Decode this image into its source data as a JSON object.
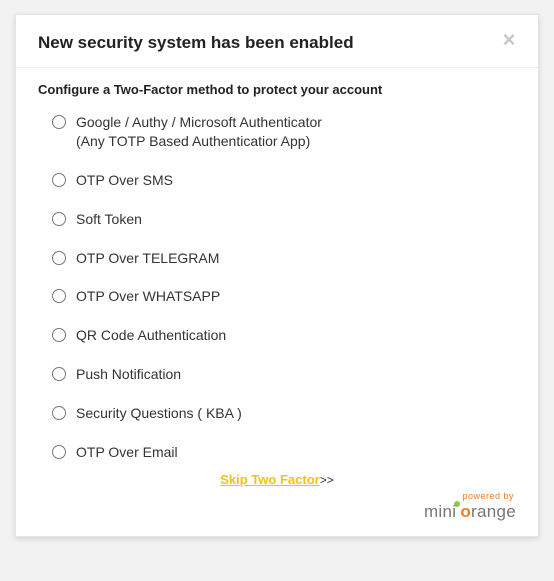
{
  "modal": {
    "title": "New security system has been enabled",
    "close_glyph": "×",
    "subtitle": "Configure a Two-Factor method to protect your account",
    "options": [
      {
        "label": "Google / Authy / Microsoft Authenticator",
        "sublabel": "(Any TOTP Based Authenticatior App)"
      },
      {
        "label": "OTP Over SMS"
      },
      {
        "label": "Soft Token"
      },
      {
        "label": "OTP Over TELEGRAM"
      },
      {
        "label": "OTP Over WHATSAPP"
      },
      {
        "label": "QR Code Authentication"
      },
      {
        "label": "Push Notification"
      },
      {
        "label": "Security Questions ( KBA )"
      },
      {
        "label": "OTP Over Email"
      }
    ],
    "skip_label": "Skip Two Factor",
    "skip_arrows": ">>",
    "powered_by": "powered by",
    "brand_mini": "mini",
    "brand_o": "o",
    "brand_range": "range"
  }
}
